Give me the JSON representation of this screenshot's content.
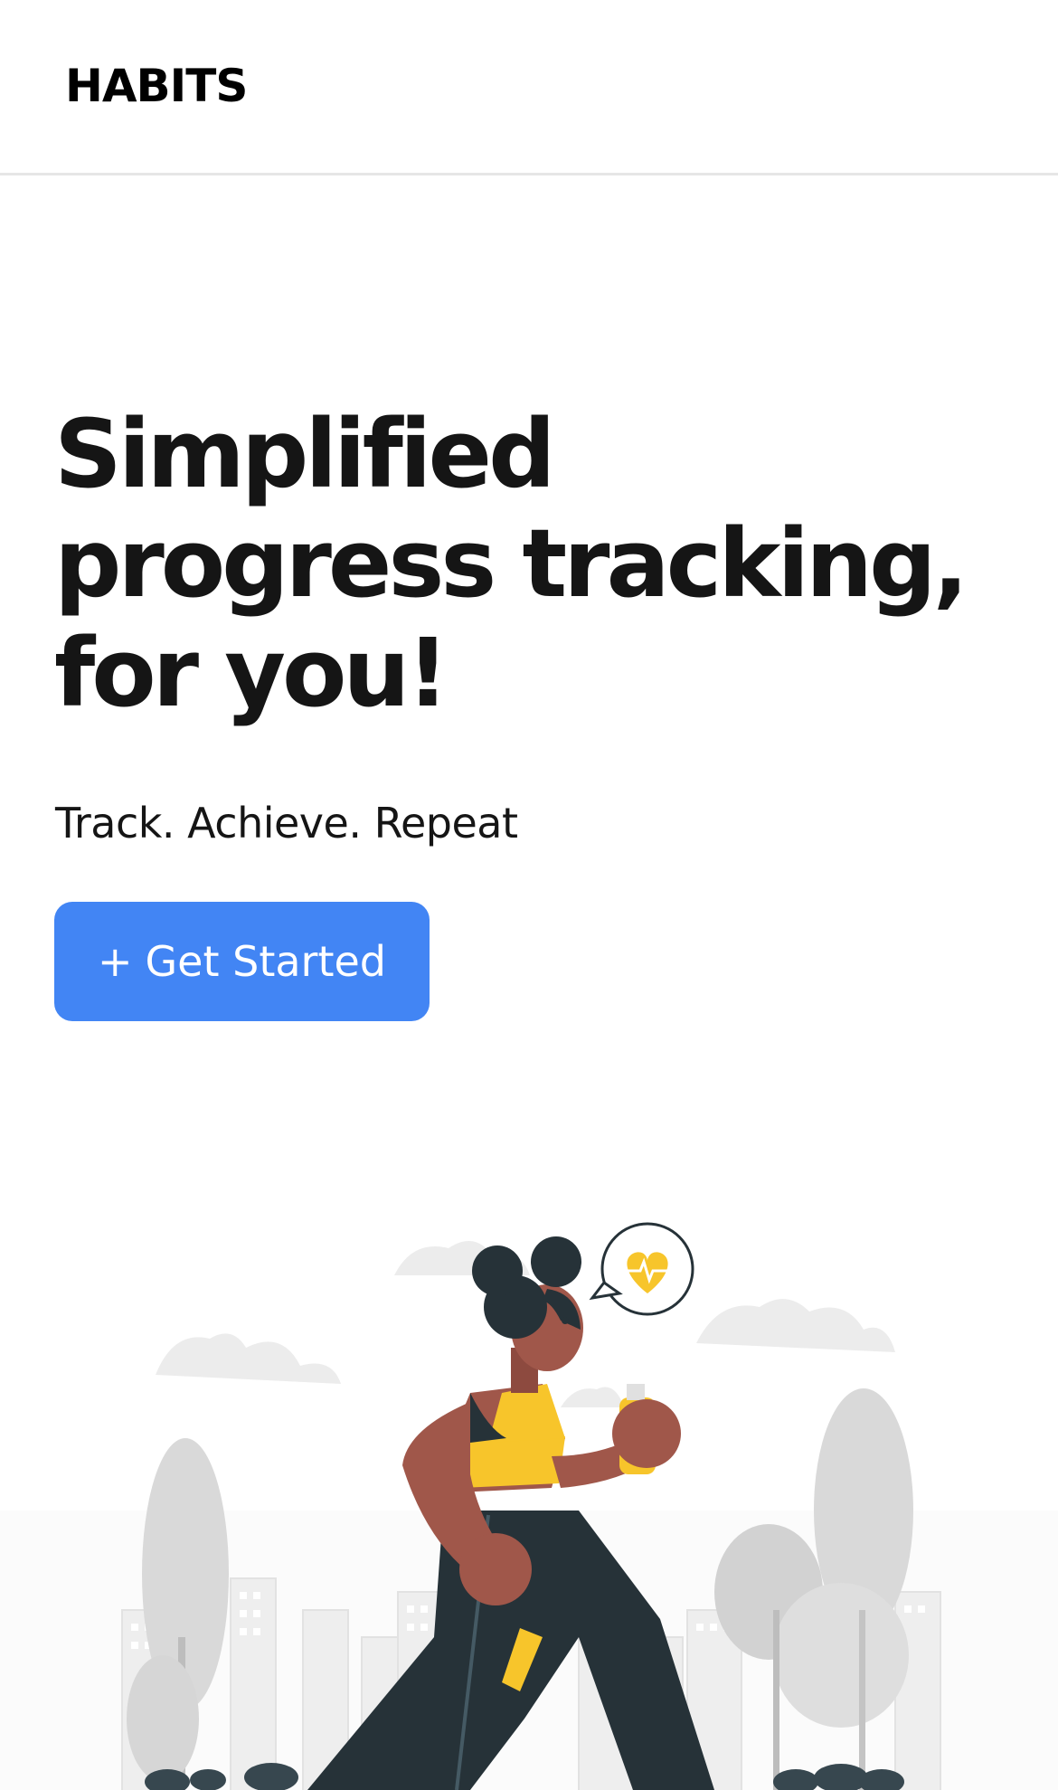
{
  "navbar": {
    "brand": "HABITS"
  },
  "hero": {
    "title_lines": [
      "Simplified",
      "progress tracking,",
      "for you!"
    ],
    "tagline": "Track. Achieve. Repeat",
    "cta": {
      "icon": "+",
      "label": "Get Started"
    }
  },
  "colors": {
    "accent": "#4285f4",
    "text": "#151515",
    "figure_yellow": "#f7c52b",
    "figure_skin": "#a0574a",
    "figure_dark": "#263238"
  },
  "icons": {
    "heart": "heart-icon"
  }
}
